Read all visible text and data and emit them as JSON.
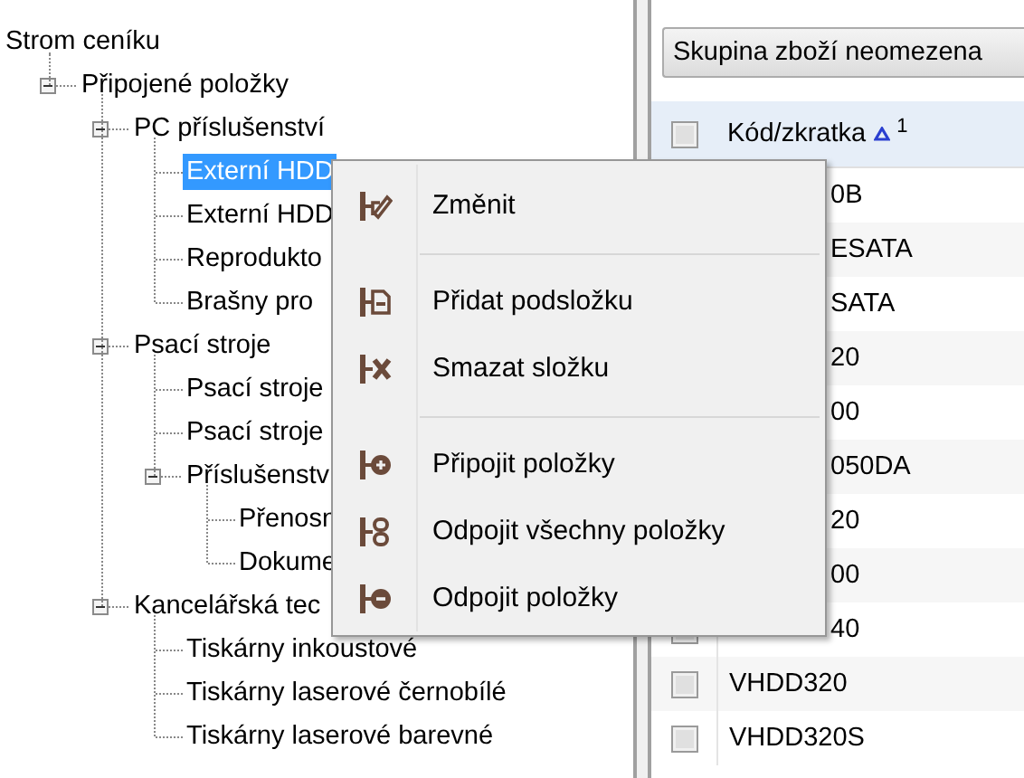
{
  "tree": {
    "title": "Strom ceníku",
    "children": [
      {
        "label": "Připojené položky",
        "expanded": true,
        "selected": false,
        "children": [
          {
            "label": "PC příslušenství",
            "expanded": true,
            "selected": false,
            "children": [
              {
                "label": "Externí HDD",
                "selected": true
              },
              {
                "label": "Externí HDD",
                "selected": false
              },
              {
                "label": "Reprodukto",
                "selected": false
              },
              {
                "label": "Brašny pro",
                "selected": false
              }
            ]
          },
          {
            "label": "Psací stroje",
            "expanded": true,
            "selected": false,
            "children": [
              {
                "label": "Psací stroje",
                "selected": false
              },
              {
                "label": "Psací stroje",
                "selected": false
              },
              {
                "label": "Příslušenstv",
                "expanded": true,
                "selected": false,
                "children": [
                  {
                    "label": "Přenosn",
                    "selected": false
                  },
                  {
                    "label": "Dokume",
                    "selected": false
                  }
                ]
              }
            ]
          },
          {
            "label": "Kancelářská tec",
            "expanded": true,
            "selected": false,
            "children": [
              {
                "label": "Tiskárny inkoustové",
                "selected": false
              },
              {
                "label": "Tiskárny laserové černobílé",
                "selected": false
              },
              {
                "label": "Tiskárny laserové barevné",
                "selected": false
              }
            ]
          }
        ]
      }
    ]
  },
  "filter_dropdown": "Skupina zboží neomezena",
  "table": {
    "header_checked": false,
    "column": {
      "label": "Kód/zkratka",
      "sort_order": "1"
    },
    "rows": [
      {
        "code": "0B"
      },
      {
        "code": "ESATA"
      },
      {
        "code": "SATA"
      },
      {
        "code": "20"
      },
      {
        "code": "00"
      },
      {
        "code": "050DA"
      },
      {
        "code": "20"
      },
      {
        "code": "00"
      },
      {
        "code": "40",
        "checked": false
      },
      {
        "code": "VHDD320",
        "checked": false
      },
      {
        "code": "VHDD320S",
        "checked": false
      }
    ]
  },
  "context_menu": {
    "items": [
      {
        "kind": "item",
        "label": "Změnit"
      },
      {
        "kind": "separator"
      },
      {
        "kind": "item",
        "label": "Přidat podsložku"
      },
      {
        "kind": "item",
        "label": "Smazat složku"
      },
      {
        "kind": "separator"
      },
      {
        "kind": "item",
        "label": "Připojit položky"
      },
      {
        "kind": "item",
        "label": "Odpojit všechny položky"
      },
      {
        "kind": "item",
        "label": "Odpojit položky"
      }
    ]
  }
}
